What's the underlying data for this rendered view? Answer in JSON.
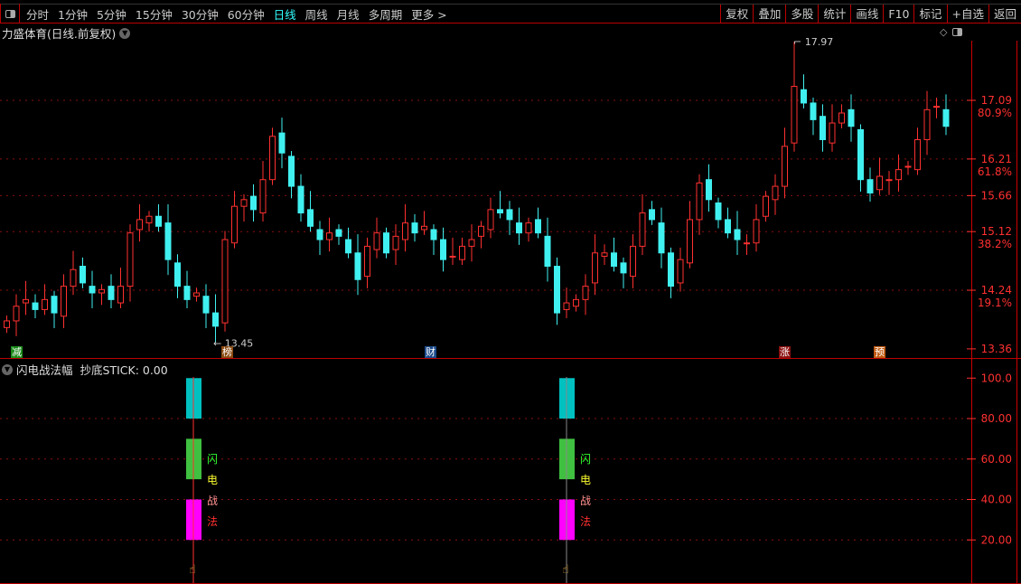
{
  "toolbar": {
    "periods": [
      "分时",
      "1分钟",
      "5分钟",
      "15分钟",
      "30分钟",
      "60分钟",
      "日线",
      "周线",
      "月线",
      "多周期",
      "更多 >"
    ],
    "active_period": "日线",
    "right_buttons": [
      "复权",
      "叠加",
      "多股",
      "统计",
      "画线",
      "F10",
      "标记",
      "+自选",
      "返回"
    ]
  },
  "chart": {
    "title": "力盛体育(日线.前复权)",
    "price_labels": [
      {
        "price": "17.09",
        "pct": "80.9%"
      },
      {
        "price": "16.21",
        "pct": "61.8%"
      },
      {
        "price": "15.66",
        "pct": ""
      },
      {
        "price": "15.12",
        "pct": "38.2%"
      },
      {
        "price": "14.24",
        "pct": "19.1%"
      },
      {
        "price": "13.36",
        "pct": ""
      }
    ],
    "high_label": "17.97",
    "low_label": "13.45",
    "badges": [
      {
        "text": "减",
        "color": "#1a8a1a"
      },
      {
        "text": "榜",
        "color": "#8a4a10"
      },
      {
        "text": "财",
        "color": "#1a4a8a"
      },
      {
        "text": "涨",
        "color": "#8a1010"
      },
      {
        "text": "预",
        "color": "#c05a10"
      }
    ],
    "colors": {
      "up": "#ff3030",
      "down": "#40f0f0",
      "grid": "#8a1010",
      "axis": "#ff3030"
    }
  },
  "chart_data": {
    "type": "candlestick",
    "close": [
      13.78,
      14.0,
      14.1,
      13.95,
      14.1,
      13.9,
      14.3,
      14.55,
      14.35,
      14.2,
      14.25,
      14.1,
      14.3,
      15.1,
      15.3,
      15.35,
      15.2,
      14.7,
      14.3,
      14.1,
      14.2,
      13.9,
      13.7,
      15.0,
      15.5,
      15.6,
      15.45,
      15.9,
      16.55,
      16.3,
      15.8,
      15.4,
      15.2,
      15.0,
      15.1,
      15.05,
      14.8,
      14.4,
      14.9,
      15.1,
      14.8,
      15.05,
      15.25,
      15.1,
      15.2,
      15.0,
      14.7,
      14.75,
      14.9,
      15.0,
      15.2,
      15.45,
      15.4,
      15.3,
      15.1,
      15.25,
      15.1,
      14.6,
      13.9,
      14.05,
      14.1,
      14.3,
      14.8,
      14.8,
      14.6,
      14.5,
      14.9,
      15.4,
      15.3,
      14.8,
      14.3,
      14.7,
      15.3,
      15.85,
      15.6,
      15.3,
      15.1,
      15.0,
      14.95,
      15.3,
      15.65,
      15.8,
      16.4,
      17.3,
      17.05,
      16.8,
      16.5,
      16.75,
      16.9,
      16.7,
      15.9,
      15.7,
      15.95,
      15.9,
      16.05,
      16.1,
      16.5,
      16.95,
      17.0,
      16.7
    ],
    "max_high": 17.97,
    "min_low": 13.45,
    "ylim": [
      13.3,
      18.1
    ]
  },
  "indicator": {
    "title": "闪电战法幅",
    "value_label": "抄底STICK: 0.00",
    "axis_labels": [
      "100.0",
      "80.00",
      "60.00",
      "40.00",
      "20.00"
    ],
    "signal_chars": [
      {
        "t": "闪",
        "c": "#30ff30"
      },
      {
        "t": "电",
        "c": "#ffff30"
      },
      {
        "t": "战",
        "c": "#ff9090"
      },
      {
        "t": "法",
        "c": "#ff3030"
      }
    ],
    "bands": [
      {
        "from": 80,
        "to": 100,
        "color": "#00c0c0"
      },
      {
        "from": 50,
        "to": 70,
        "color": "#40c040"
      },
      {
        "from": 20,
        "to": 40,
        "color": "#ff00ff"
      }
    ]
  }
}
